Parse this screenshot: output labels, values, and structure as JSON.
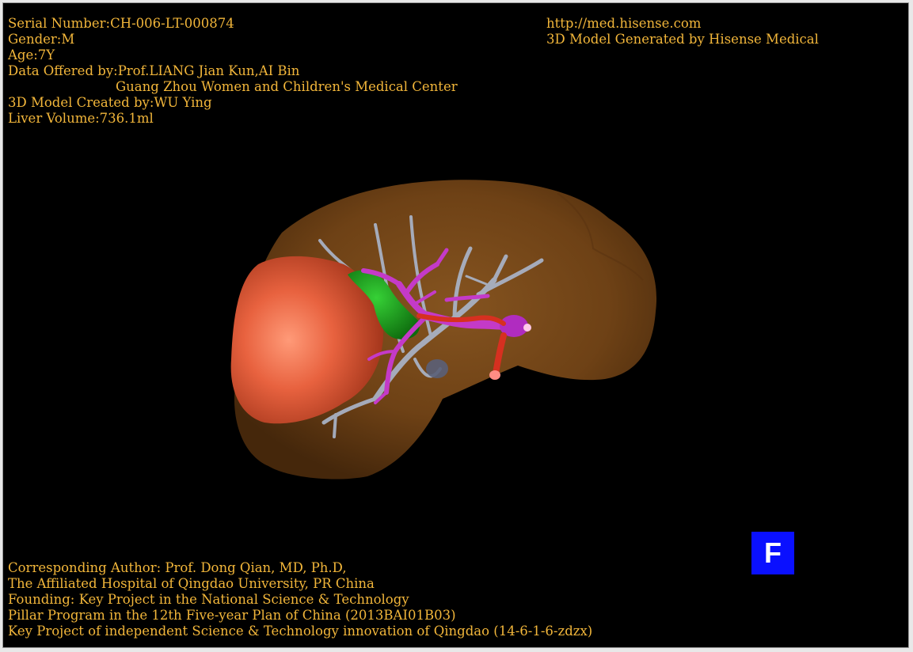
{
  "info": {
    "serial_number": "Serial Number:CH-006-LT-000874",
    "gender": "Gender:M",
    "age": "Age:7Y",
    "data_offered_by": "Data Offered by:Prof.LIANG Jian Kun,AI Bin",
    "institution": "Guang Zhou Women and Children's Medical Center",
    "model_created_by": "3D Model Created by:WU Ying",
    "liver_volume": "Liver Volume:736.1ml"
  },
  "header_right": {
    "url": "http://med.hisense.com",
    "generated_by": "3D Model Generated by Hisense Medical"
  },
  "footer": {
    "lines": [
      "Corresponding Author: Prof. Dong Qian, MD, Ph.D,",
      "The Affiliated Hospital of Qingdao University, PR China",
      "Founding: Key Project in the National Science & Technology",
      "Pillar Program in the 12th Five-year Plan of China (2013BAI01B03)",
      "Key Project of independent Science & Technology innovation of Qingdao (14-6-1-6-zdzx)"
    ]
  },
  "orientation_marker": {
    "label": "F"
  },
  "colors": {
    "background": "#000000",
    "overlay_text": "#f2b63a",
    "liver": "#7a4a18",
    "tumor": "#e25a3a",
    "gallbladder": "#1fa81f",
    "portal_vein": "#c43ac8",
    "hepatic_vein": "#aab4c8",
    "artery": "#d63020",
    "orientation_marker": "#0a10ff"
  }
}
